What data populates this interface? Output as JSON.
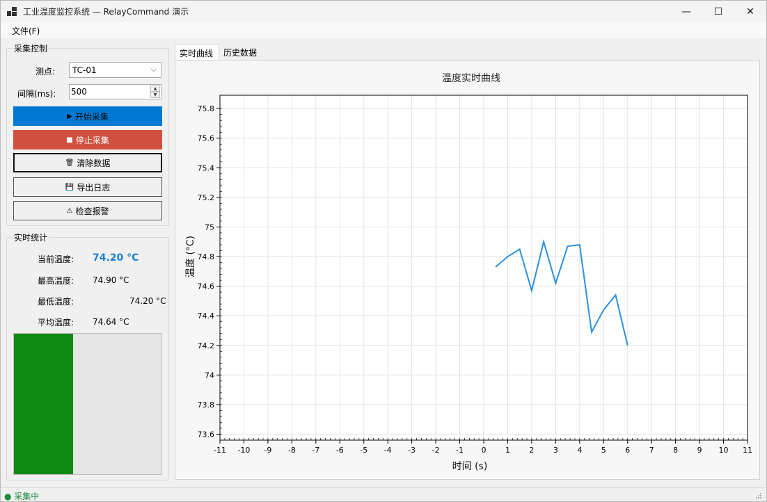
{
  "window": {
    "title": "工业温度监控系统 — RelayCommand 演示",
    "minimize_glyph": "—",
    "maximize_glyph": "☐",
    "close_glyph": "✕"
  },
  "menu": {
    "file": "文件(F)"
  },
  "acquisition": {
    "group_title": "采集控制",
    "point_label": "测点:",
    "point_value": "TC-01",
    "interval_label": "间隔(ms):",
    "interval_value": "500",
    "start_icon": "▶",
    "start_label": "开始采集",
    "stop_icon": "■",
    "stop_label": "停止采集",
    "clear_icon": "🗑",
    "clear_label": "清除数据",
    "export_icon": "💾",
    "export_label": "导出日志",
    "alarm_icon": "⚠",
    "alarm_label": "检查报警"
  },
  "stats": {
    "group_title": "实时统计",
    "current_label": "当前温度:",
    "current_value": "74.20 °C",
    "max_label": "最高温度:",
    "max_value": "74.90 °C",
    "min_label": "最低温度:",
    "min_value": "74.20 °C",
    "avg_label": "平均温度:",
    "avg_value": "74.64 °C",
    "level_fraction": 0.4
  },
  "tabs": {
    "realtime": "实时曲线",
    "history": "历史数据"
  },
  "status": {
    "text": "● 采集中"
  },
  "colors": {
    "accent": "#0078d4",
    "stop": "#d05040",
    "line": "#2b8fde",
    "level": "#0e8a12"
  },
  "chart_data": {
    "type": "line",
    "title": "温度实时曲线",
    "xlabel": "时间 (s)",
    "ylabel": "温度 (°C)",
    "xlim": [
      -11,
      11
    ],
    "ylim": [
      73.56,
      75.89
    ],
    "xticks": [
      -11,
      -10,
      -9,
      -8,
      -7,
      -6,
      -5,
      -4,
      -3,
      -2,
      -1,
      0,
      1,
      2,
      3,
      4,
      5,
      6,
      7,
      8,
      9,
      10,
      11
    ],
    "yticks": [
      73.6,
      73.8,
      74,
      74.2,
      74.4,
      74.6,
      74.8,
      75,
      75.2,
      75.4,
      75.6,
      75.8
    ],
    "ytick_labels": [
      "73.6",
      "73.8",
      "74",
      "74.2",
      "74.4",
      "74.6",
      "74.8",
      "75",
      "75.2",
      "75.4",
      "75.6",
      "75.8"
    ],
    "grid": true,
    "series": [
      {
        "x": [
          0.5,
          1.0,
          1.5,
          2.0,
          2.5,
          3.0,
          3.5,
          4.0,
          4.5,
          5.0,
          5.5,
          6.0
        ],
        "y": [
          74.73,
          74.8,
          74.85,
          74.57,
          74.9,
          74.62,
          74.87,
          74.88,
          74.29,
          74.44,
          74.54,
          74.2
        ]
      }
    ]
  }
}
